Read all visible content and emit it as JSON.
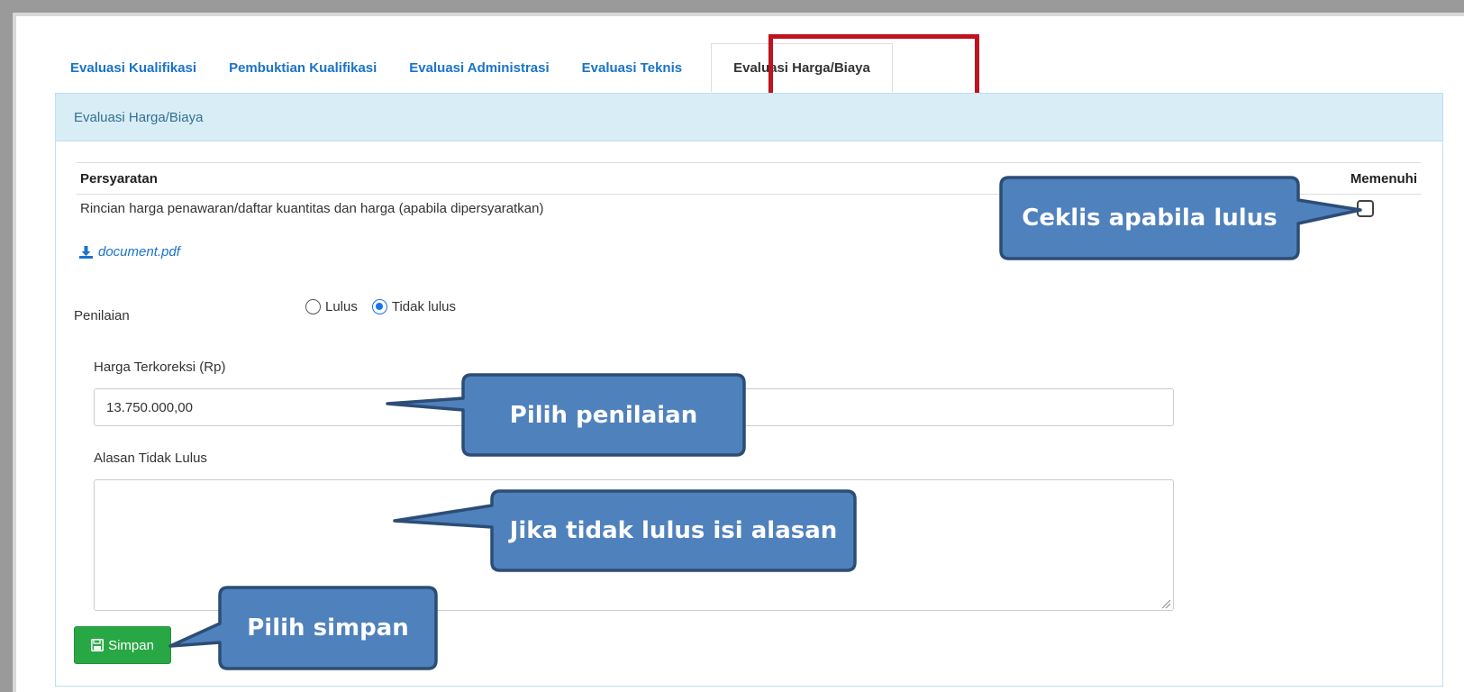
{
  "tabs": [
    {
      "label": "Evaluasi Kualifikasi",
      "active": false
    },
    {
      "label": "Pembuktian Kualifikasi",
      "active": false
    },
    {
      "label": "Evaluasi Administrasi",
      "active": false
    },
    {
      "label": "Evaluasi Teknis",
      "active": false
    },
    {
      "label": "Evaluasi Harga/Biaya",
      "active": true
    }
  ],
  "panel": {
    "heading": "Evaluasi Harga/Biaya"
  },
  "requirements": {
    "col_requirement": "Persyaratan",
    "col_fulfilled": "Memenuhi",
    "rows": [
      {
        "text": "Rincian harga penawaran/daftar kuantitas dan harga (apabila dipersyaratkan)",
        "checked": false
      }
    ]
  },
  "document": {
    "link_text": "document.pdf",
    "icon": "download-icon"
  },
  "assessment": {
    "label": "Penilaian",
    "options": [
      {
        "label": "Lulus",
        "checked": false
      },
      {
        "label": "Tidak lulus",
        "checked": true
      }
    ]
  },
  "corrected_price": {
    "label": "Harga Terkoreksi (Rp)",
    "value": "13.750.000,00"
  },
  "failure_reason": {
    "label": "Alasan Tidak Lulus",
    "value": ""
  },
  "save_button": {
    "label": "Simpan",
    "icon": "floppy-disk-icon"
  },
  "callouts": {
    "check": "Ceklis apabila lulus",
    "assessment": "Pilih penilaian",
    "reason": "Jika tidak lulus isi alasan",
    "save": "Pilih simpan"
  },
  "colors": {
    "tab_link": "#1a73c9",
    "highlight_border": "#c0121f",
    "panel_heading_bg": "#d9edf7",
    "save_button": "#28a745",
    "callout_fill": "#4f81bd",
    "callout_border": "#2c4d75"
  }
}
